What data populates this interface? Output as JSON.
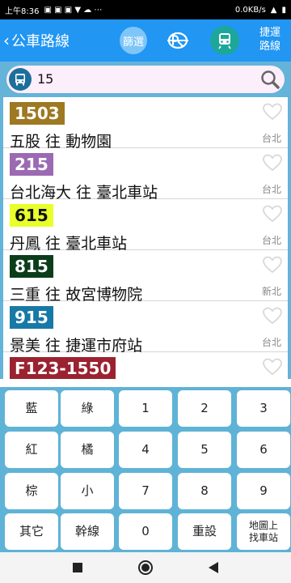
{
  "status_bar": {
    "time": "上午8:36",
    "network_speed": "0.0KB/s"
  },
  "app_bar": {
    "title": "公車路線",
    "filter_label": "篩選",
    "metro_routes_label_line1": "捷運",
    "metro_routes_label_line2": "路線"
  },
  "search": {
    "value": "15"
  },
  "routes": [
    {
      "number": "1503",
      "desc": "五股 往 動物園",
      "region": "台北",
      "badge_bg": "#9e7922",
      "badge_fg": "#ffffff"
    },
    {
      "number": "215",
      "desc": "台北海大 往 臺北車站",
      "region": "台北",
      "badge_bg": "#9b6ab3",
      "badge_fg": "#ffffff"
    },
    {
      "number": "615",
      "desc": "丹鳳 往 臺北車站",
      "region": "台北",
      "badge_bg": "#e8ff29",
      "badge_fg": "#111111"
    },
    {
      "number": "815",
      "desc": "三重 往 故宮博物院",
      "region": "新北",
      "badge_bg": "#0b3d1a",
      "badge_fg": "#ffffff"
    },
    {
      "number": "915",
      "desc": "景美 往 捷運市府站",
      "region": "台北",
      "badge_bg": "#1779a6",
      "badge_fg": "#ffffff"
    },
    {
      "number": "F123-1550",
      "desc": "",
      "region": "",
      "badge_bg": "#9b2230",
      "badge_fg": "#ffffff"
    }
  ],
  "keypad": {
    "blue": "藍",
    "green": "綠",
    "red": "紅",
    "orange": "橘",
    "brown": "棕",
    "small": "小",
    "other": "其它",
    "trunk": "幹線",
    "reset": "重設",
    "map_line1": "地圖上",
    "map_line2": "找車站",
    "d0": "0",
    "d1": "1",
    "d2": "2",
    "d3": "3",
    "d4": "4",
    "d5": "5",
    "d6": "6",
    "d7": "7",
    "d8": "8",
    "d9": "9"
  },
  "colors": {
    "app_bar": "#2196f3",
    "search_area": "#64b3d9",
    "keypad_bg": "#5fb3d6"
  },
  "icons": {
    "back": "chevron-left-icon",
    "bus_logo": "bus-logo-icon",
    "metro": "metro-train-icon",
    "search": "magnifier-icon",
    "favorite": "heart-outline-icon"
  }
}
